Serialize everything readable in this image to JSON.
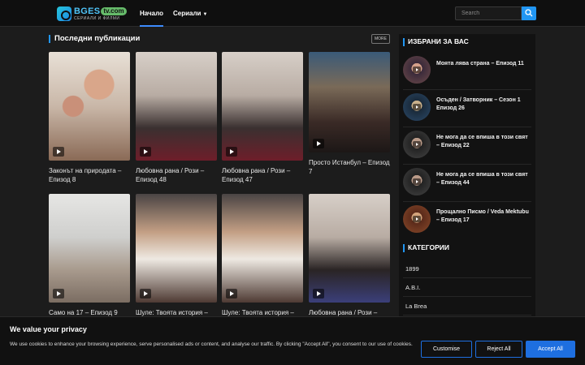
{
  "header": {
    "logo": {
      "name": "BGES",
      "tld": "tv.com",
      "tagline": "СЕРИАЛИ И ФИЛМИ"
    },
    "nav": [
      {
        "label": "Начало",
        "active": true
      },
      {
        "label": "Сериали",
        "dropdown": true
      }
    ],
    "search": {
      "placeholder": "Search",
      "icon": "search-icon"
    }
  },
  "main": {
    "section_title": "Последни публикации",
    "more_label": "MORE",
    "posts": [
      {
        "title": "Законът на природата – Епизод 8"
      },
      {
        "title": "Любовна рана / Рози – Епизод 48"
      },
      {
        "title": "Любовна рана / Рози – Епизод 47"
      },
      {
        "title": "Просто Истанбул – Епизод 7"
      },
      {
        "title": "Само на 17 – Епизод 9"
      },
      {
        "title": "Шуле: Твоята история –"
      },
      {
        "title": "Шуле: Твоята история –"
      },
      {
        "title": "Любовна рана / Рози –"
      }
    ]
  },
  "sidebar": {
    "featured_title": "ИЗБРАНИ ЗА ВАС",
    "featured": [
      {
        "title": "Моята лява страна – Епизод 11"
      },
      {
        "title": "Осъден / Затворник – Сезон 1 Епизод 26"
      },
      {
        "title": "Не мога да се впиша в този свят – Епизод 22"
      },
      {
        "title": "Не мога да се впиша в този свят – Епизод 44"
      },
      {
        "title": "Прощално Писмо / Veda Mektubu – Епизод 17"
      }
    ],
    "categories_title": "КАТЕГОРИИ",
    "categories": [
      "1899",
      "A.B.I.",
      "La Brea"
    ]
  },
  "cookie": {
    "title": "We value your privacy",
    "text": "We use cookies to enhance your browsing experience, serve personalised ads or content, and analyse our traffic. By clicking \"Accept All\", you consent to our use of cookies.",
    "customise": "Customise",
    "reject": "Reject All",
    "accept": "Accept All"
  },
  "colors": {
    "accent": "#2196f3",
    "button_blue": "#1e6fe0",
    "background": "#1c1c1c",
    "header": "#0f0f0f"
  }
}
